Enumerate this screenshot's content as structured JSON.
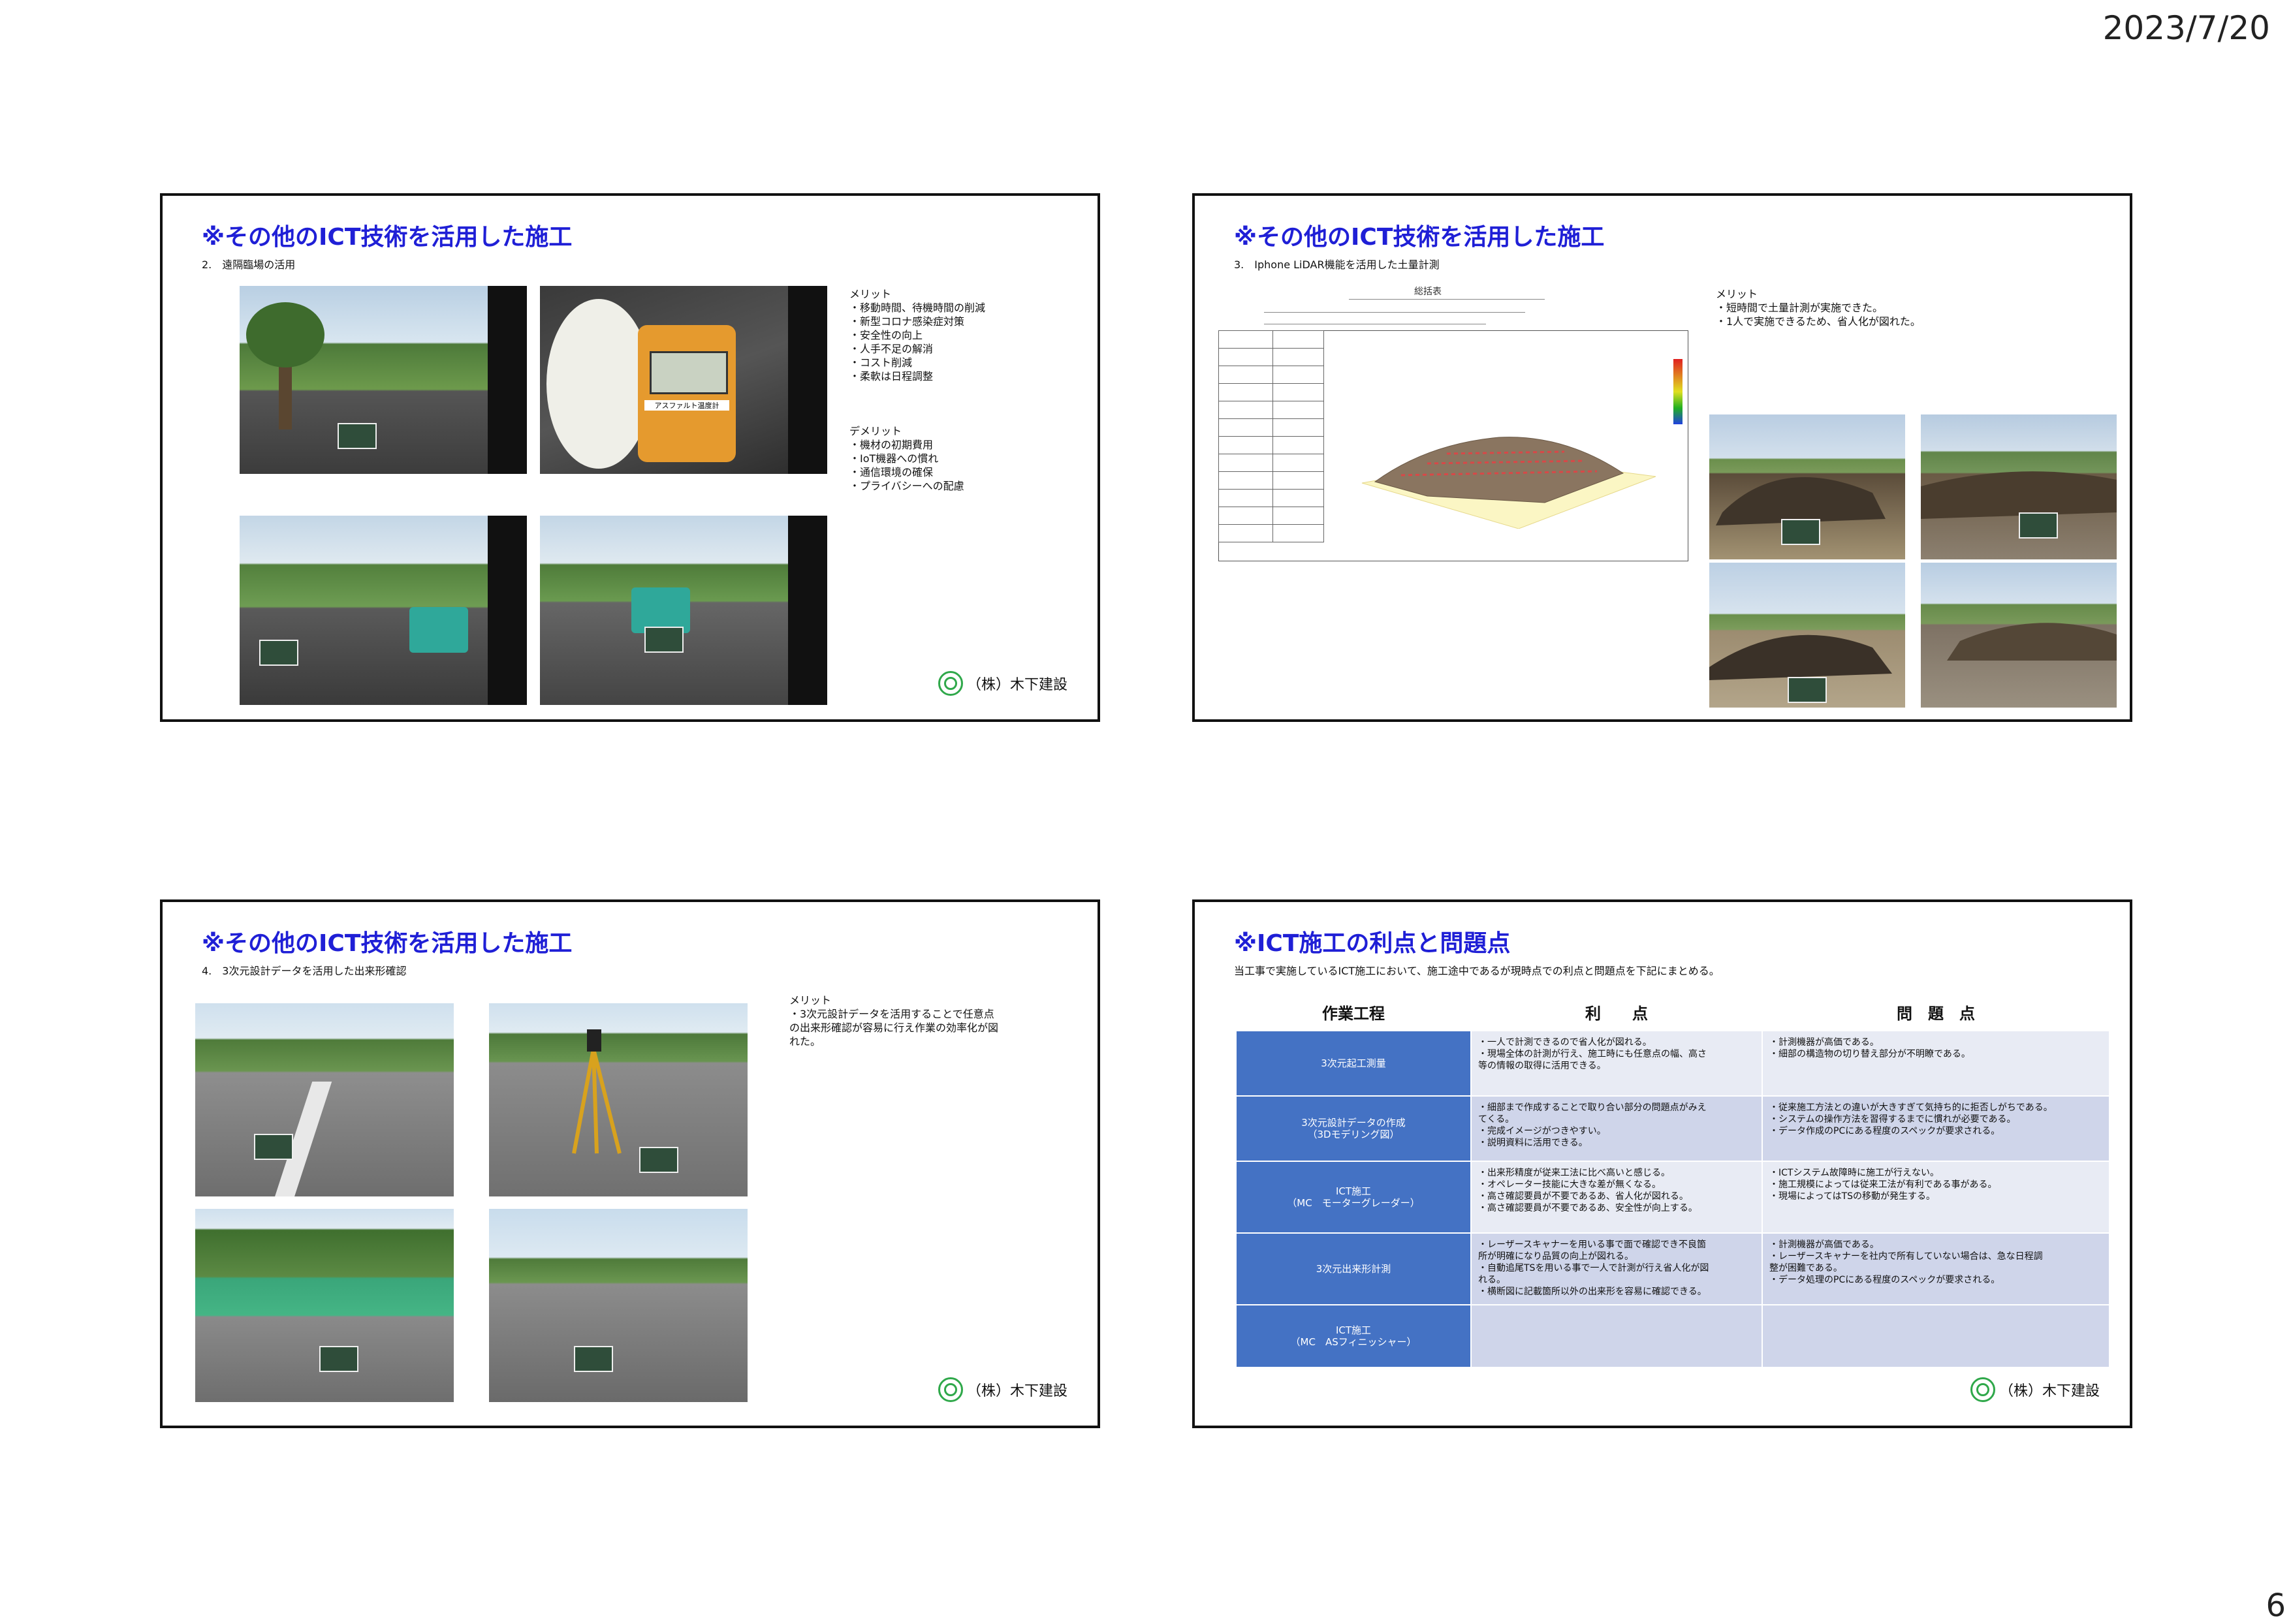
{
  "header": {
    "date": "2023/7/20"
  },
  "footer": {
    "page_number": "6"
  },
  "company": "（株）木下建設",
  "slide1": {
    "title": "※その他のICT技術を活用した施工",
    "subtitle": "2.　遠隔臨場の活用",
    "merit_heading": "メリット",
    "merits": [
      "・移動時間、待機時間の削減",
      "・新型コロナ感染症対策",
      "・安全性の向上",
      "・人手不足の解消",
      "・コスト削減",
      "・柔軟は日程調整"
    ],
    "demerit_heading": "デメリット",
    "demerits": [
      "・機材の初期費用",
      "・IoT機器への慣れ",
      "・通信環境の確保",
      "・プライバシーへの配慮"
    ],
    "meter_label": "アスファルト温度計"
  },
  "slide2": {
    "title": "※その他のICT技術を活用した施工",
    "subtitle": "3.　Iphone LiDAR機能を活用した土量計測",
    "sheet_title": "総括表",
    "merit_heading": "メリット",
    "merits": [
      "・短時間で土量計測が実施できた。",
      "・1人で実施できるため、省人化が図れた。"
    ]
  },
  "slide3": {
    "title": "※その他のICT技術を活用した施工",
    "subtitle": "4.　3次元設計データを活用した出来形確認",
    "merit_heading": "メリット",
    "merit_lines": [
      "・3次元設計データを活用することで任意点",
      "の出来形確認が容易に行え作業の効率化が図",
      "れた。"
    ]
  },
  "slide4": {
    "title": "※ICT施工の利点と問題点",
    "subtitle": "当工事で実施しているICT施工において、施工途中であるが現時点での利点と問題点を下記にまとめる。",
    "headers": [
      "作業工程",
      "利　　点",
      "問　題　点"
    ],
    "rows": [
      {
        "process": [
          "3次元起工測量"
        ],
        "merits": [
          "・一人で計測できるので省人化が図れる。",
          "・現場全体の計測が行え、施工時にも任意点の幅、高さ",
          "等の情報の取得に活用できる。"
        ],
        "problems": [
          "・計測機器が高価である。",
          "・細部の構造物の切り替え部分が不明瞭である。"
        ]
      },
      {
        "process": [
          "3次元設計データの作成",
          "（3Dモデリング図）"
        ],
        "merits": [
          "・細部まで作成することで取り合い部分の問題点がみえ",
          "てくる。",
          "・完成イメージがつきやすい。",
          "・説明資料に活用できる。"
        ],
        "problems": [
          "・従来施工方法との違いが大きすぎて気持ち的に拒否しがちである。",
          "・システムの操作方法を習得するまでに慣れが必要である。",
          "・データ作成のPCにある程度のスペックが要求される。"
        ]
      },
      {
        "process": [
          "ICT施工",
          "（MC　モーターグレーダー）"
        ],
        "merits": [
          "・出来形精度が従来工法に比べ高いと感じる。",
          "・オペレーター技能に大きな差が無くなる。",
          "・高さ確認要員が不要であるあ、省人化が図れる。",
          "・高さ確認要員が不要であるあ、安全性が向上する。"
        ],
        "problems": [
          "・ICTシステム故障時に施工が行えない。",
          "・施工規模によっては従来工法が有利である事がある。",
          "・現場によってはTSの移動が発生する。"
        ]
      },
      {
        "process": [
          "3次元出来形計測"
        ],
        "merits": [
          "・レーザースキャナーを用いる事で面で確認でき不良箇",
          "所が明確になり品質の向上が図れる。",
          "・自動追尾TSを用いる事で一人で計測が行え省人化が図",
          "れる。",
          "・横断図に記載箇所以外の出来形を容易に確認できる。"
        ],
        "problems": [
          "・計測機器が高価である。",
          "・レーザースキャナーを社内で所有していない場合は、急な日程調",
          "整が困難である。",
          "・データ処理のPCにある程度のスペックが要求される。"
        ]
      },
      {
        "process": [
          "ICT施工",
          "（MC　ASフィニッシャー）"
        ],
        "merits": [],
        "problems": []
      }
    ]
  }
}
